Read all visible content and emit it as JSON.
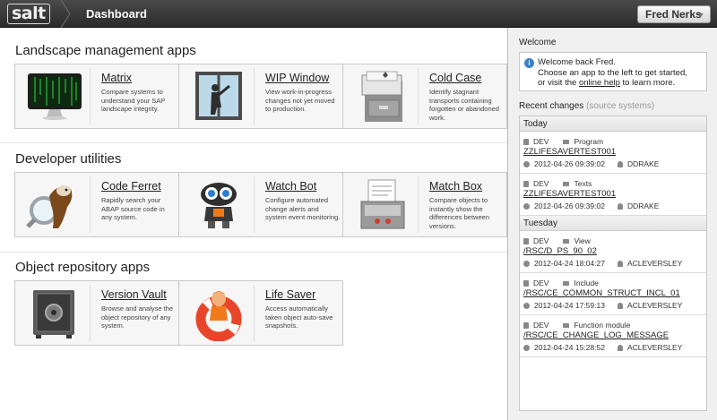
{
  "app": {
    "logo": "salt",
    "page_title": "Dashboard",
    "user": "Fred Nerks"
  },
  "sections": [
    {
      "title": "Landscape management apps",
      "cards": [
        {
          "name": "Matrix",
          "desc": "Compare systems to understand your SAP landscape integrity.",
          "icon": "matrix-monitor-icon"
        },
        {
          "name": "WIP Window",
          "desc": "View work-in-progress changes not yet moved to production.",
          "icon": "window-cleaner-icon"
        },
        {
          "name": "Cold Case",
          "desc": "Identify stagnant transports containing forgotten or abandoned work.",
          "icon": "filing-cabinet-icon"
        }
      ]
    },
    {
      "title": "Developer utilities",
      "cards": [
        {
          "name": "Code Ferret",
          "desc": "Rapidly search your ABAP source code in any system.",
          "icon": "ferret-magnifier-icon"
        },
        {
          "name": "Watch Bot",
          "desc": "Configure automated change alerts and system event monitoring.",
          "icon": "robot-icon"
        },
        {
          "name": "Match Box",
          "desc": "Compare objects to instantly show the differences between versions.",
          "icon": "document-tray-icon"
        }
      ]
    },
    {
      "title": "Object repository apps",
      "cards": [
        {
          "name": "Version Vault",
          "desc": "Browse and analyse the object repository of any system.",
          "icon": "safe-icon"
        },
        {
          "name": "Life Saver",
          "desc": "Access automatically taken object auto-save snapshots.",
          "icon": "lifeguard-ring-icon"
        }
      ]
    }
  ],
  "sidebar": {
    "welcome_heading": "Welcome",
    "welcome_line1": "Welcome back Fred.",
    "welcome_line2": "Choose an app to the left to get started,",
    "welcome_line3_pre": "or visit the",
    "welcome_link": "online help",
    "welcome_line3_post": "to learn more.",
    "changes_heading": "Recent changes",
    "changes_sub": "(source systems)",
    "groups": [
      {
        "day": "Today",
        "entries": [
          {
            "system": "DEV",
            "type": "Program",
            "object": "ZZLIFESAVERTEST001",
            "timestamp": "2012-04-26 09:39:02",
            "user": "DDRAKE"
          },
          {
            "system": "DEV",
            "type": "Texts",
            "object": "ZZLIFESAVERTEST001",
            "timestamp": "2012-04-26 09:39:02",
            "user": "DDRAKE"
          }
        ]
      },
      {
        "day": "Tuesday",
        "entries": [
          {
            "system": "DEV",
            "type": "View",
            "object": "/RSC/D_PS_90_02",
            "timestamp": "2012-04-24 18:04:27",
            "user": "ACLEVERSLEY"
          },
          {
            "system": "DEV",
            "type": "Include",
            "object": "/RSC/CE_COMMON_STRUCT_INCL_01",
            "timestamp": "2012-04-24 17:59:13",
            "user": "ACLEVERSLEY"
          },
          {
            "system": "DEV",
            "type": "Function module",
            "object": "/RSC/CE_CHANGE_LOG_MESSAGE",
            "timestamp": "2012-04-24 15:28:52",
            "user": "ACLEVERSLEY"
          }
        ]
      }
    ]
  }
}
